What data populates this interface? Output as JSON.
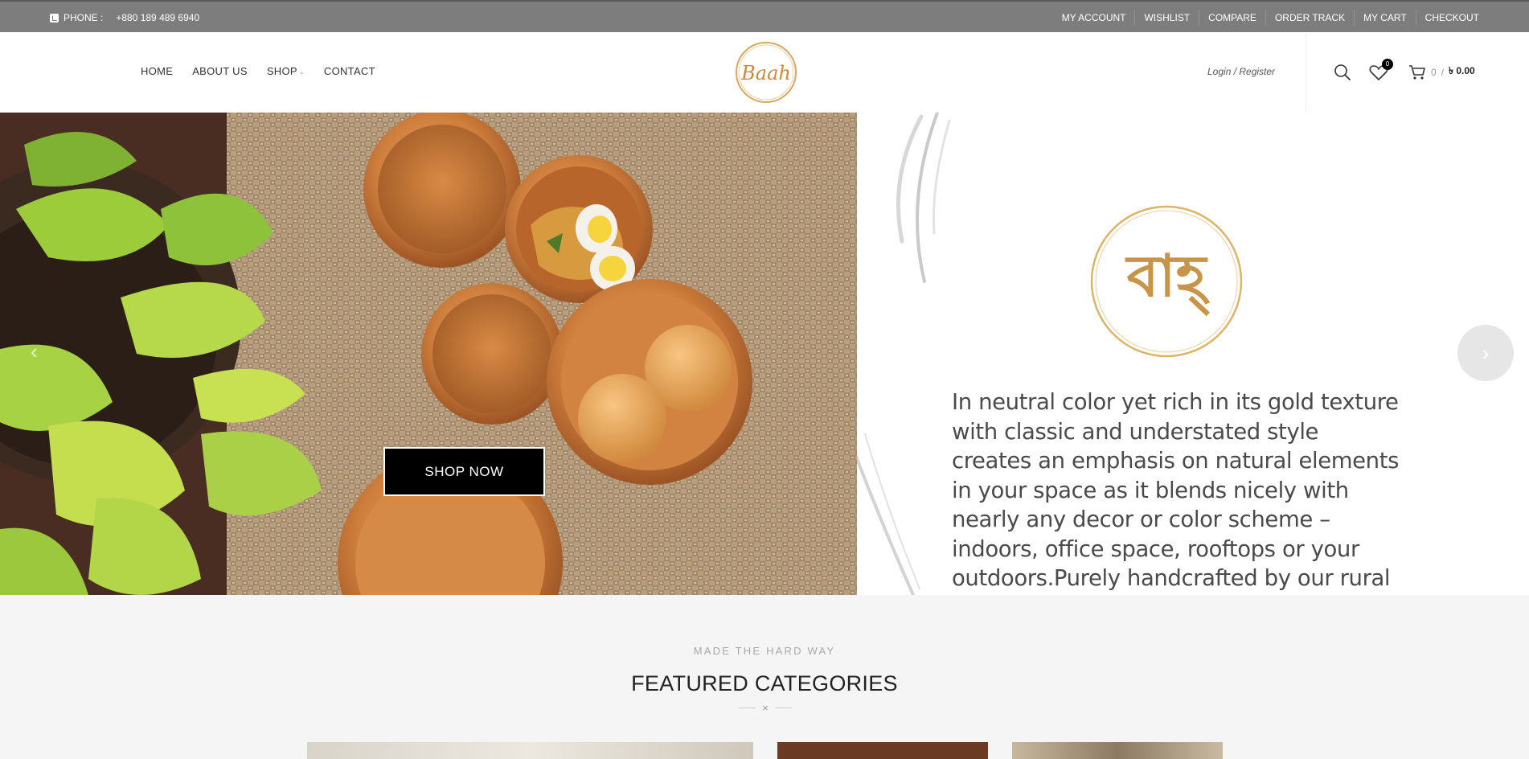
{
  "topbar": {
    "phone_label": "PHONE :",
    "phone_number": "+880 189 489 6940",
    "links": [
      "MY ACCOUNT",
      "WISHLIST",
      "COMPARE",
      "ORDER TRACK",
      "MY CART",
      "CHECKOUT"
    ]
  },
  "nav": {
    "items": [
      "HOME",
      "ABOUT US",
      "SHOP",
      "CONTACT"
    ],
    "shop_has_dropdown": true
  },
  "logo": {
    "text": "Baah"
  },
  "header": {
    "login_register": "Login / Register",
    "wishlist_count": "0",
    "cart_count": "0",
    "cart_separator": "/",
    "cart_total": "৳ 0.00"
  },
  "hero": {
    "cta_label": "SHOP NOW",
    "brand_glyph": "বাহ্",
    "description": "In neutral color yet rich in its gold texture with classic and understated style creates an emphasis on natural elements in your space as it blends nicely with nearly any decor or color scheme – indoors, office space, rooftops or your outdoors.Purely handcrafted by our rural women artisans.",
    "prev_icon": "‹",
    "next_icon": "›"
  },
  "featured": {
    "kicker": "MADE THE HARD WAY",
    "title": "FEATURED CATEGORIES",
    "divider_icon": "×"
  },
  "colors": {
    "topbar_bg": "#7d7d7d",
    "gold_accent": "#d4a253",
    "section_bg": "#f5f5f5",
    "cta_bg": "#000000"
  }
}
